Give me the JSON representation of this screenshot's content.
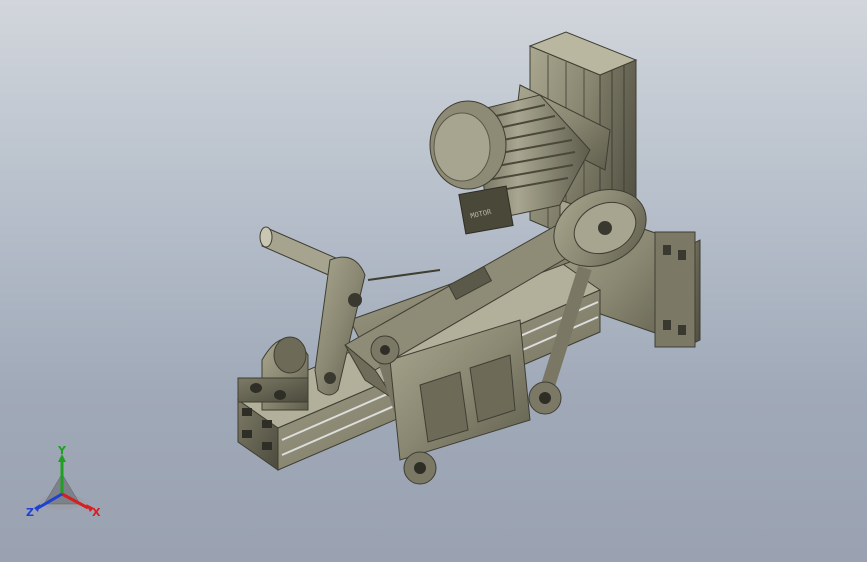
{
  "viewport": {
    "background_top": "#d2d6dc",
    "background_bottom": "#9aa2b2"
  },
  "model": {
    "description_icon": "belt-grinder-assembly",
    "motor_label": "MOTOR"
  },
  "triad": {
    "x_label": "X",
    "y_label": "Y",
    "z_label": "Z",
    "x_color": "#d42020",
    "y_color": "#20a020",
    "z_color": "#2040d0"
  }
}
